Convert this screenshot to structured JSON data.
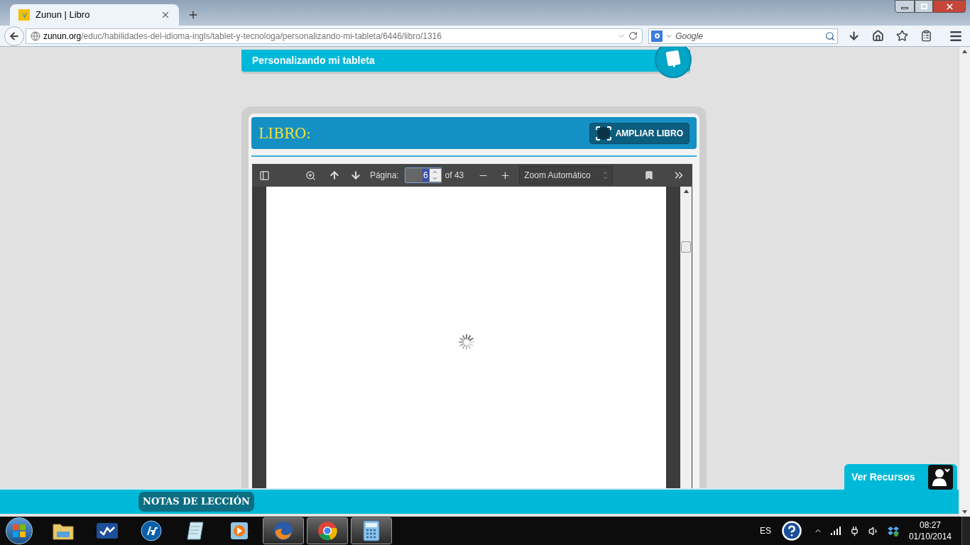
{
  "browser": {
    "tab": {
      "title": "Zunun | Libro",
      "selected": true
    },
    "url": {
      "domain": "zunun.org",
      "path": "/educ/habilidades-del-idioma-ingls/tablet-y-tecnologa/personalizando-mi-tableta/6446/libro/1316"
    },
    "search": {
      "placeholder": "Google"
    }
  },
  "lesson": {
    "title": "Personalizando mi tableta"
  },
  "book": {
    "title": "LIBRO:",
    "expand_button": "AMPLIAR LIBRO"
  },
  "viewer": {
    "page_label": "Página:",
    "page": "6",
    "page_count": "of 43",
    "zoom": "Zoom Automático",
    "loading": true
  },
  "resources_tab": {
    "label": "Ver Recursos"
  },
  "notes_button": "NOTAS DE LECCIÓN",
  "taskbar": {
    "apps": [
      {
        "kind": "folder",
        "open": false
      },
      {
        "kind": "check",
        "open": false
      },
      {
        "kind": "hp",
        "open": false
      },
      {
        "kind": "notepad",
        "open": false
      },
      {
        "kind": "player",
        "open": false
      },
      {
        "kind": "firefox",
        "open": true
      },
      {
        "kind": "chrome",
        "open": true
      },
      {
        "kind": "calculator",
        "open": true
      }
    ],
    "language": "ES",
    "time": "08:27",
    "date": "01/10/2014"
  }
}
